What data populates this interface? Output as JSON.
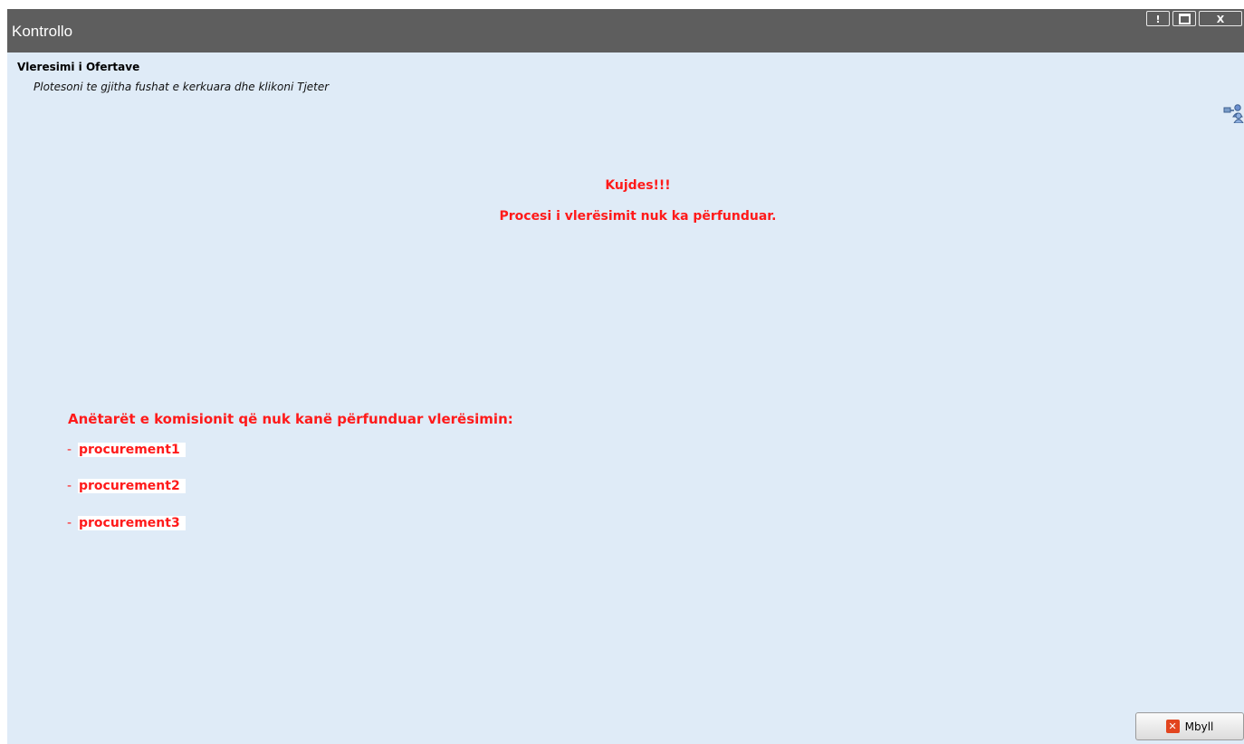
{
  "window": {
    "title": "Kontrollo",
    "buttons": {
      "alert": "!",
      "close": "X"
    }
  },
  "header": {
    "title": "Vleresimi i Ofertave",
    "instructions": "Plotesoni te gjitha fushat e kerkuara dhe klikoni Tjeter"
  },
  "warning": {
    "title": "Kujdes!!!",
    "message": "Procesi i vlerësimit nuk ka përfunduar."
  },
  "members": {
    "title": "Anëtarët e komisionit që nuk kanë përfunduar vlerësimin:",
    "prefix": "-",
    "items": [
      "procurement1",
      "procurement2",
      "procurement3"
    ]
  },
  "footer": {
    "close_label": "Mbyll"
  },
  "icons": {
    "network": "network-users-icon",
    "close": "close-icon"
  },
  "colors": {
    "titlebar": "#5e5e5e",
    "background": "#dfebf7",
    "warning": "#ff1a1a",
    "close_icon": "#e2451f"
  }
}
